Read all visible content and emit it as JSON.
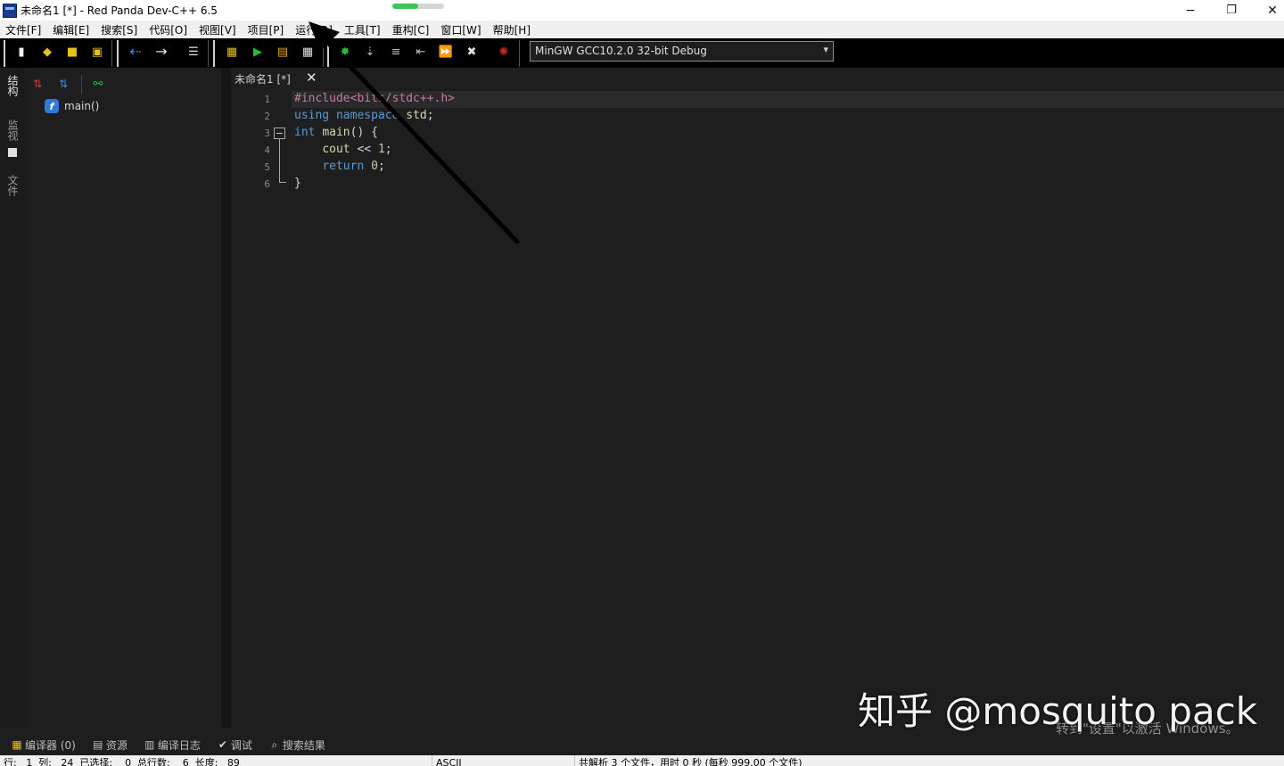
{
  "window": {
    "title": "未命名1 [*] - Red Panda Dev-C++ 6.5",
    "progress_fraction": 0.5,
    "minimize": "−",
    "restore": "❐",
    "close": "✕"
  },
  "menu": [
    "文件[F]",
    "编辑[E]",
    "搜索[S]",
    "代码[O]",
    "视图[V]",
    "项目[P]",
    "运行[R]",
    "工具[T]",
    "重构[C]",
    "窗口[W]",
    "帮助[H]"
  ],
  "toolbar": {
    "compiler_selected": "MinGW GCC10.2.0 32-bit Debug",
    "colors": {
      "run_green": "#22c03a",
      "accent_yellow": "#e8c21a",
      "arrow_blue": "#3b8fe0",
      "stop_red": "#d02a2a"
    }
  },
  "left_tabs": [
    "结构",
    "监视",
    "文件"
  ],
  "class_browser": {
    "items": [
      {
        "label": "main()",
        "icon": "function-icon"
      }
    ]
  },
  "editor": {
    "tab_label": "未命名1 [*]",
    "tab_close": "✕",
    "line_numbers": [
      "1",
      "2",
      "3",
      "4",
      "5",
      "6"
    ],
    "code": [
      "#include<bits/stdc++.h>",
      "using namespace std;",
      "int main() {",
      "    cout << 1;",
      "    return 0;",
      "}"
    ]
  },
  "bottom_tabs": [
    {
      "label": "编译器 (0)",
      "icon": "compiler-icon"
    },
    {
      "label": "资源",
      "icon": "resource-icon"
    },
    {
      "label": "编译日志",
      "icon": "log-chart-icon"
    },
    {
      "label": "调试",
      "icon": "check-icon"
    },
    {
      "label": "搜索结果",
      "icon": "search-result-icon"
    }
  ],
  "status": {
    "position": "行:   1  列:   24  已选择:    0  总行数:    6  长度:   89",
    "encoding": "ASCII",
    "parse": "共解析 3 个文件，用时 0 秒 (每秒 999.00 个文件)"
  },
  "overlay": {
    "watermark": "知乎 @mosquito pack",
    "activate_windows": "转到\"设置\"以激活 Windows。"
  }
}
